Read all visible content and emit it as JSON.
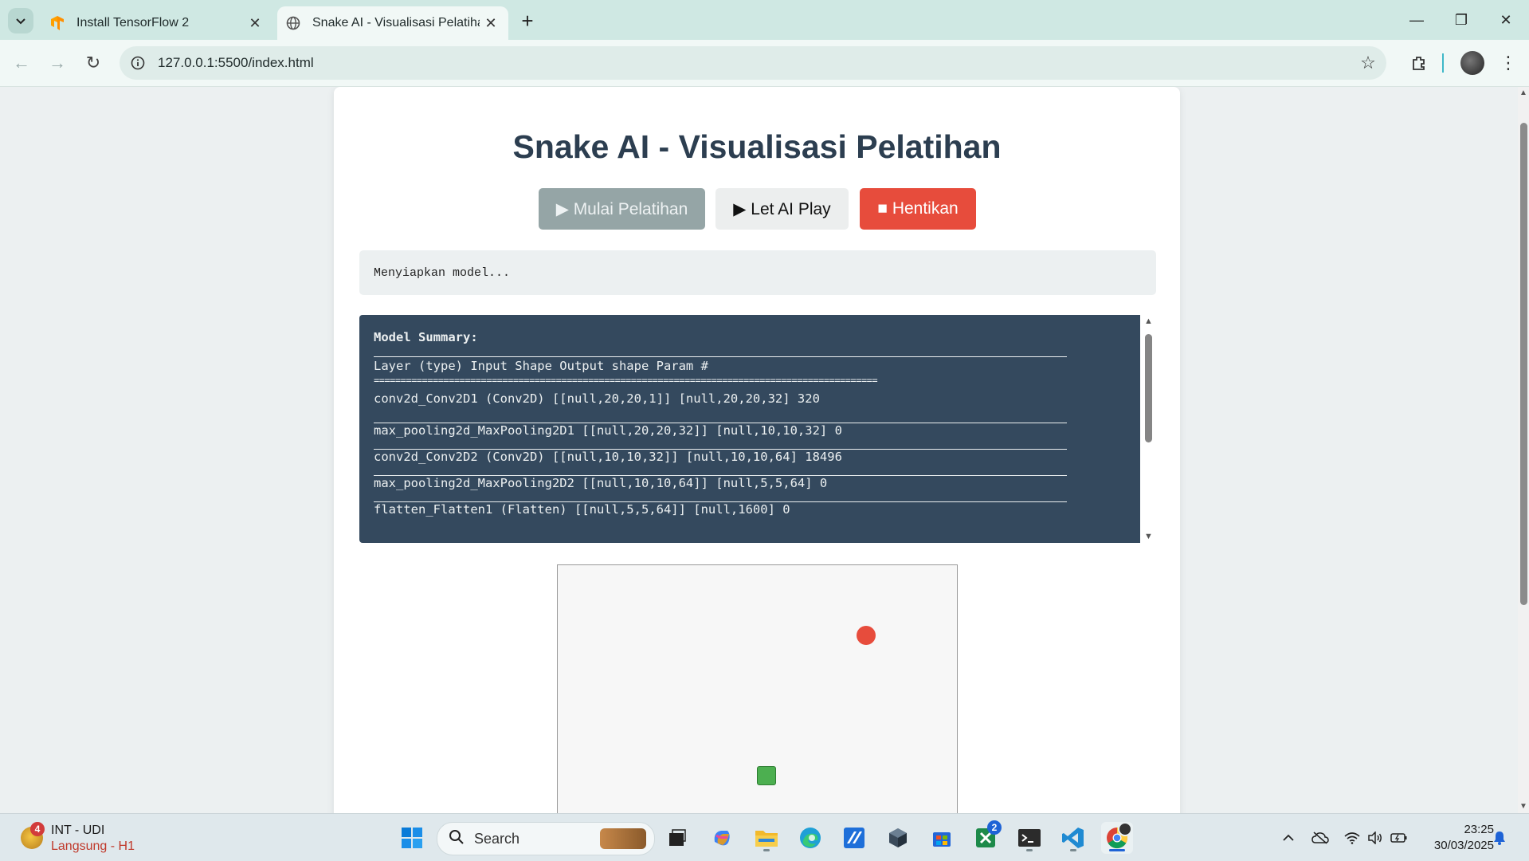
{
  "browser": {
    "tabs": [
      {
        "title": "Install TensorFlow 2",
        "active": false
      },
      {
        "title": "Snake AI - Visualisasi Pelatihan",
        "active": true
      }
    ],
    "url": "127.0.0.1:5500/index.html"
  },
  "page": {
    "title": "Snake AI - Visualisasi Pelatihan",
    "buttons": {
      "start": "▶ Mulai Pelatihan",
      "play": "▶ Let AI Play",
      "stop": "■ Hentikan"
    },
    "status": "Menyiapkan model...",
    "summary": {
      "heading": "Model Summary:",
      "header_row": "Layer (type) Input Shape Output shape Param #",
      "separator": "==============================================================================================",
      "rows": [
        "conv2d_Conv2D1 (Conv2D) [[null,20,20,1]] [null,20,20,32] 320",
        "max_pooling2d_MaxPooling2D1 [[null,20,20,32]] [null,10,10,32] 0",
        "conv2d_Conv2D2 (Conv2D) [[null,10,10,32]] [null,10,10,64] 18496",
        "max_pooling2d_MaxPooling2D2 [[null,10,10,64]] [null,5,5,64] 0",
        "flatten_Flatten1 (Flatten) [[null,5,5,64]] [null,1600] 0"
      ]
    },
    "game": {
      "food_color": "#e74c3c",
      "snake_color": "#4caf50"
    }
  },
  "taskbar": {
    "weather_badge": "4",
    "weather_line1": "INT - UDI",
    "weather_line2": "Langsung - H1",
    "search_placeholder": "Search",
    "edge_badge": "2",
    "time": "23:25",
    "date": "30/03/2025"
  }
}
